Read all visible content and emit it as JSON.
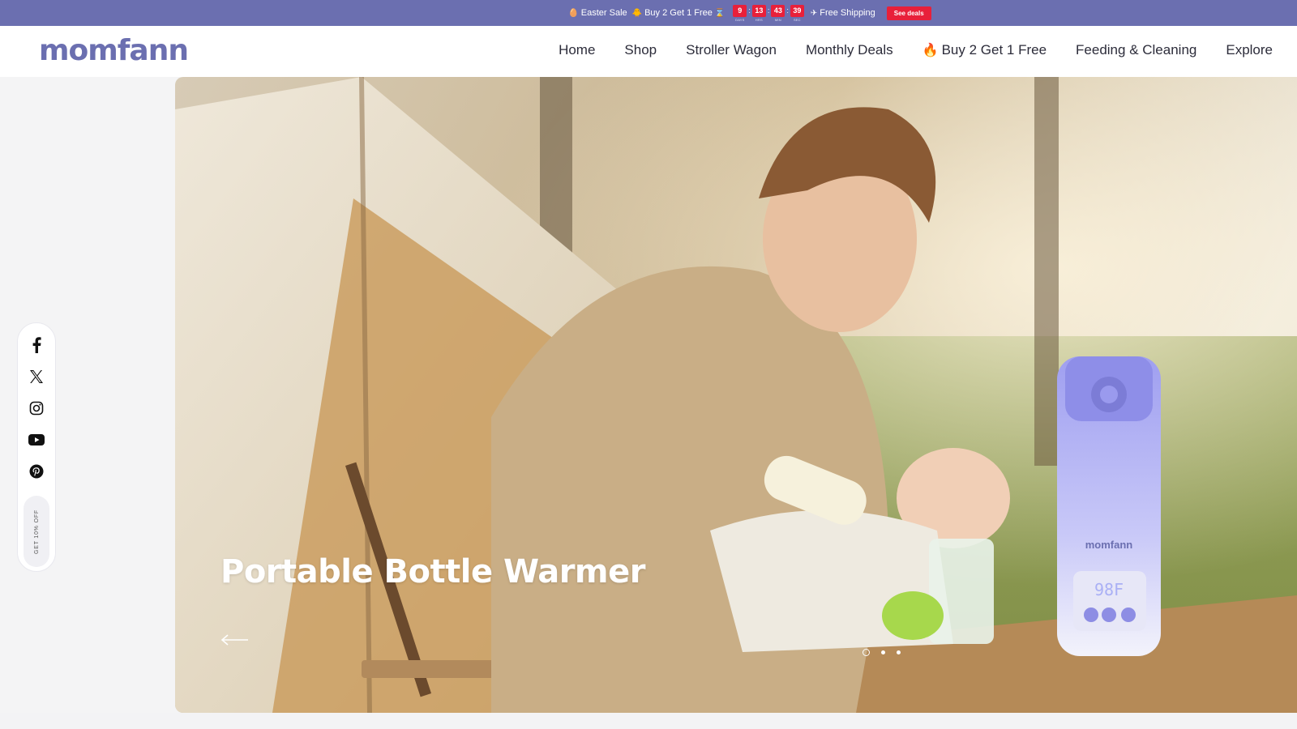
{
  "announcement": {
    "easter": "Easter Sale",
    "bogo": "Buy 2 Get 1 Free",
    "countdown": [
      {
        "value": "9",
        "label": "DAYS"
      },
      {
        "value": "13",
        "label": "HRS"
      },
      {
        "value": "43",
        "label": "MIN"
      },
      {
        "value": "39",
        "label": "SEC"
      }
    ],
    "shipping": "Free Shipping",
    "cta": "See deals",
    "bg_color": "#6b6fb0",
    "badge_color": "#e8203a"
  },
  "header": {
    "logo": "momfann",
    "nav": [
      {
        "label": "Home"
      },
      {
        "label": "Shop"
      },
      {
        "label": "Stroller Wagon"
      },
      {
        "label": "Monthly Deals"
      },
      {
        "label": "Buy 2 Get 1 Free",
        "icon": "fire-icon"
      },
      {
        "label": "Feeding & Cleaning"
      },
      {
        "label": "Explore"
      }
    ]
  },
  "hero": {
    "title": "Portable Bottle Warmer",
    "product_brand": "momfann",
    "product_display": "98F",
    "slides": 3,
    "active_slide": 1
  },
  "social": {
    "icons": [
      "facebook-icon",
      "x-icon",
      "instagram-icon",
      "youtube-icon",
      "pinterest-icon"
    ],
    "promo": "GET 10% OFF"
  }
}
